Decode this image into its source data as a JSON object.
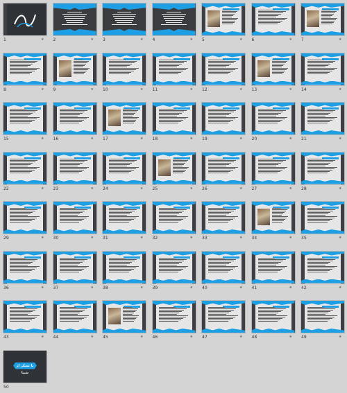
{
  "slides": [
    {
      "number": "1",
      "kind": "title"
    },
    {
      "number": "2",
      "kind": "dark"
    },
    {
      "number": "3",
      "kind": "dark"
    },
    {
      "number": "4",
      "kind": "dark"
    },
    {
      "number": "5",
      "kind": "picture"
    },
    {
      "number": "6",
      "kind": "text"
    },
    {
      "number": "7",
      "kind": "picture"
    },
    {
      "number": "8",
      "kind": "text"
    },
    {
      "number": "9",
      "kind": "picture"
    },
    {
      "number": "10",
      "kind": "text"
    },
    {
      "number": "11",
      "kind": "text"
    },
    {
      "number": "12",
      "kind": "text"
    },
    {
      "number": "13",
      "kind": "picture"
    },
    {
      "number": "14",
      "kind": "text"
    },
    {
      "number": "15",
      "kind": "text"
    },
    {
      "number": "16",
      "kind": "text"
    },
    {
      "number": "17",
      "kind": "picture"
    },
    {
      "number": "18",
      "kind": "text"
    },
    {
      "number": "19",
      "kind": "text"
    },
    {
      "number": "20",
      "kind": "text"
    },
    {
      "number": "21",
      "kind": "text"
    },
    {
      "number": "22",
      "kind": "text"
    },
    {
      "number": "23",
      "kind": "text"
    },
    {
      "number": "24",
      "kind": "text"
    },
    {
      "number": "25",
      "kind": "picture"
    },
    {
      "number": "26",
      "kind": "text"
    },
    {
      "number": "27",
      "kind": "text"
    },
    {
      "number": "28",
      "kind": "text"
    },
    {
      "number": "29",
      "kind": "text"
    },
    {
      "number": "30",
      "kind": "text"
    },
    {
      "number": "31",
      "kind": "text"
    },
    {
      "number": "32",
      "kind": "text"
    },
    {
      "number": "33",
      "kind": "text"
    },
    {
      "number": "34",
      "kind": "picture"
    },
    {
      "number": "35",
      "kind": "text"
    },
    {
      "number": "36",
      "kind": "text"
    },
    {
      "number": "37",
      "kind": "text"
    },
    {
      "number": "38",
      "kind": "text"
    },
    {
      "number": "39",
      "kind": "text"
    },
    {
      "number": "40",
      "kind": "text"
    },
    {
      "number": "41",
      "kind": "text"
    },
    {
      "number": "42",
      "kind": "text"
    },
    {
      "number": "43",
      "kind": "text"
    },
    {
      "number": "44",
      "kind": "text"
    },
    {
      "number": "45",
      "kind": "picture"
    },
    {
      "number": "46",
      "kind": "text"
    },
    {
      "number": "47",
      "kind": "text"
    },
    {
      "number": "48",
      "kind": "text"
    },
    {
      "number": "49",
      "kind": "text"
    },
    {
      "number": "50",
      "kind": "end"
    }
  ],
  "end_slide_text": "با تشکر از شما",
  "slide_marker_icon": "star-icon",
  "colors": {
    "accent_blue": "#1e9fe3",
    "dark_panel": "#3a3c40",
    "background": "#d4d4d4"
  }
}
